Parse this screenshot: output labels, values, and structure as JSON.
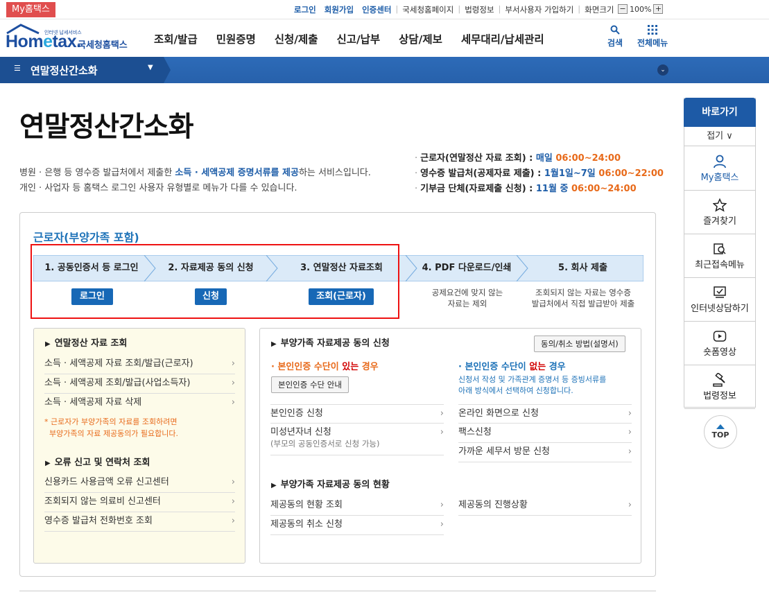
{
  "utility": {
    "my_tag": "My홈택스",
    "links": [
      {
        "label": "로그인",
        "strong": true
      },
      {
        "label": "회원가입",
        "strong": true
      },
      {
        "label": "인증센터",
        "strong": true
      },
      {
        "label": "국세청홈페이지",
        "strong": false
      },
      {
        "label": "법령정보",
        "strong": false
      },
      {
        "label": "부서사용자 가입하기",
        "strong": false
      },
      {
        "label": "화면크기",
        "strong": false
      }
    ],
    "zoom_minus": "−",
    "zoom_level": "100%",
    "zoom_plus": "+"
  },
  "header": {
    "logo_text_1": "Hom",
    "logo_text_e": "e",
    "logo_text_2": "tax.",
    "logo_kr": "국세청홈택스",
    "logo_small": "인터넷 납세서비스",
    "gnb": [
      "조회/발급",
      "민원증명",
      "신청/제출",
      "신고/납부",
      "상담/제보",
      "세무대리/납세관리"
    ],
    "search_label": "검색",
    "allmenu_label": "전체메뉴"
  },
  "navbar": {
    "title": "연말정산간소화"
  },
  "page": {
    "title": "연말정산간소화",
    "intro_line1_a": "병원 · 은행 등 영수증 발급처에서 제출한 ",
    "intro_line1_hl": "소득 · 세액공제 증명서류를 제공",
    "intro_line1_b": "하는 서비스입니다.",
    "intro_line2": "개인 · 사업자 등 홈택스 로그인 사용자 유형별로 메뉴가 다를 수 있습니다.",
    "schedule": [
      {
        "label": "근로자(연말정산 자료 조회) : ",
        "period": "매일 ",
        "time": "06:00~24:00"
      },
      {
        "label": "영수증 발급처(공제자료 제출) : ",
        "period": "1월1일~7일 ",
        "time": "06:00~22:00"
      },
      {
        "label": "기부금 단체(자료제출 신청) : ",
        "period": "11월 중 ",
        "time": "06:00~24:00"
      }
    ]
  },
  "main": {
    "section_title": "근로자(부양가족 포함)",
    "steps": [
      "1. 공동인증서 등 로그인",
      "2. 자료제공 동의 신청",
      "3. 연말정산 자료조회",
      "4. PDF 다운로드/인쇄",
      "5. 회사 제출"
    ],
    "step_buttons": [
      "로그인",
      "신청",
      "조회(근로자)"
    ],
    "step4_desc_1": "공제요건에 맞지 않는",
    "step4_desc_2": "자료는 제외",
    "step5_desc_1": "조회되지 않는 자료는 영수증",
    "step5_desc_2": "발급처에서 직접 발급받아 제출"
  },
  "left_panel": {
    "heading1": "연말정산 자료 조회",
    "items1": [
      "소득 · 세액공제 자료 조회/발급(근로자)",
      "소득 · 세액공제 조회/발급(사업소득자)",
      "소득 · 세액공제 자료 삭제"
    ],
    "note_1": "* 근로자가 부양가족의 자료를 조회하려면",
    "note_2": "부양가족의 자료 제공동의가 필요합니다.",
    "heading2": "오류 신고 및 연락처 조회",
    "items2": [
      "신용카드 사용금액 오류 신고센터",
      "조회되지 않는 의료비 신고센터",
      "영수증 발급처 전화번호 조회"
    ]
  },
  "right_panel": {
    "heading1": "부양가족 자료제공 동의 신청",
    "method_button": "동의/취소 방법(설명서)",
    "has_auth_a": "본인인증 수단이 ",
    "has_auth_red": "있는",
    "has_auth_b": " 경우",
    "auth_guide_button": "본인인증 수단 안내",
    "no_auth_a": "본인인증 수단이 ",
    "no_auth_red": "없는",
    "no_auth_b": " 경우",
    "no_auth_note_1": "신청서 작성 및 가족관계 증명서 등 증빙서류를",
    "no_auth_note_2": "아래 방식에서 선택하여 신청합니다.",
    "left_items": [
      "본인인증 신청",
      "미성년자녀 신청"
    ],
    "minor_note": "(부모의 공동인증서로 신청 가능)",
    "right_items": [
      "온라인 화면으로 신청",
      "팩스신청",
      "가까운 세무서 방문 신청"
    ],
    "heading2": "부양가족 자료제공 동의 현황",
    "status_left": [
      "제공동의 현황 조회",
      "제공동의 취소 신청"
    ],
    "status_right": [
      "제공동의 진행상황"
    ]
  },
  "quick": {
    "head": "바로가기",
    "fold": "접기 ∨",
    "items": [
      {
        "label": "My홈택스",
        "icon": "person-icon"
      },
      {
        "label": "즐겨찾기",
        "icon": "star-icon"
      },
      {
        "label": "최근접속메뉴",
        "icon": "recent-menu-icon"
      },
      {
        "label": "인터넷상담하기",
        "icon": "consult-icon"
      },
      {
        "label": "숏폼영상",
        "icon": "video-icon"
      },
      {
        "label": "법령정보",
        "icon": "gavel-icon"
      }
    ],
    "top_label": "TOP"
  },
  "colors": {
    "primary": "#1d5da8",
    "nav_bar": "#2761ab",
    "accent_orange": "#e86a1a",
    "highlight_red": "#e11",
    "step_bg": "#dbeaf8"
  }
}
